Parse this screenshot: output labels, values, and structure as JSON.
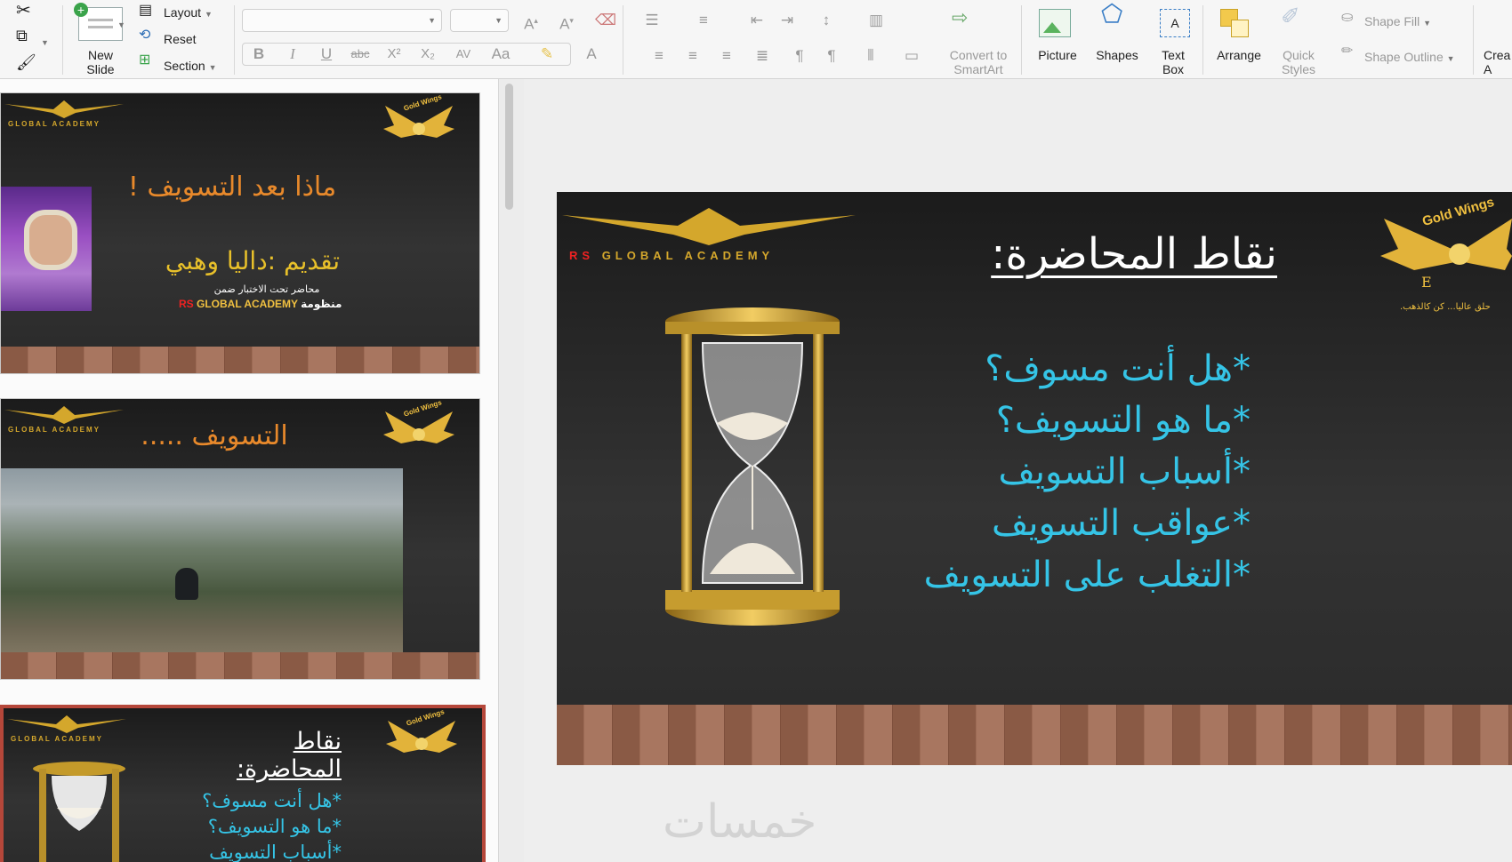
{
  "ribbon": {
    "new_slide": "New\nSlide",
    "layout": "Layout",
    "reset": "Reset",
    "section": "Section",
    "convert_smartart": "Convert to\nSmartArt",
    "picture": "Picture",
    "shapes": "Shapes",
    "text_box": "Text\nBox",
    "arrange": "Arrange",
    "quick_styles": "Quick\nStyles",
    "shape_fill": "Shape Fill",
    "shape_outline": "Shape Outline",
    "create_partial": "Crea\nA",
    "font_name_value": "",
    "font_size_value": "",
    "bold": "B",
    "italic": "I",
    "underline": "U",
    "strike": "abc",
    "superscript": "X²",
    "subscript": "X₂"
  },
  "thumbnails": [
    {
      "academy": "GLOBAL ACADEMY",
      "gold_wings": "Gold Wings",
      "title": "ماذا بعد التسويف !",
      "presenter": "تقديم :داليا وهبي",
      "subline": "محاضر تحت الاختبار ضمن",
      "org_rs": "RS",
      "org_name": "GLOBAL ACADEMY",
      "org_suffix": "منظومة"
    },
    {
      "academy": "GLOBAL ACADEMY",
      "gold_wings": "Gold Wings",
      "title": "التسويف ....."
    },
    {
      "academy": "GLOBAL ACADEMY",
      "gold_wings": "Gold Wings",
      "title": "نقاط المحاضرة:",
      "bullets": [
        "*هل أنت مسوف؟",
        "*ما هو التسويف؟",
        "*أسباب التسويف"
      ]
    }
  ],
  "main_slide": {
    "academy_rs": "RS",
    "academy_name": "GLOBAL ACADEMY",
    "gold_wings": "Gold Wings",
    "tagline": "حلق عاليا... كن كالذهب.",
    "title": "نقاط المحاضرة:",
    "bullets": [
      "*هل أنت مسوف؟",
      "*ما هو التسويف؟",
      "*أسباب التسويف",
      "*عواقب التسويف",
      "*التغلب على التسويف"
    ]
  },
  "watermark": "خمسات",
  "colors": {
    "title_orange": "#e8892b",
    "bullet_cyan": "#35c4e6",
    "gold": "#d4a72c",
    "selected_border": "#b5473a"
  }
}
